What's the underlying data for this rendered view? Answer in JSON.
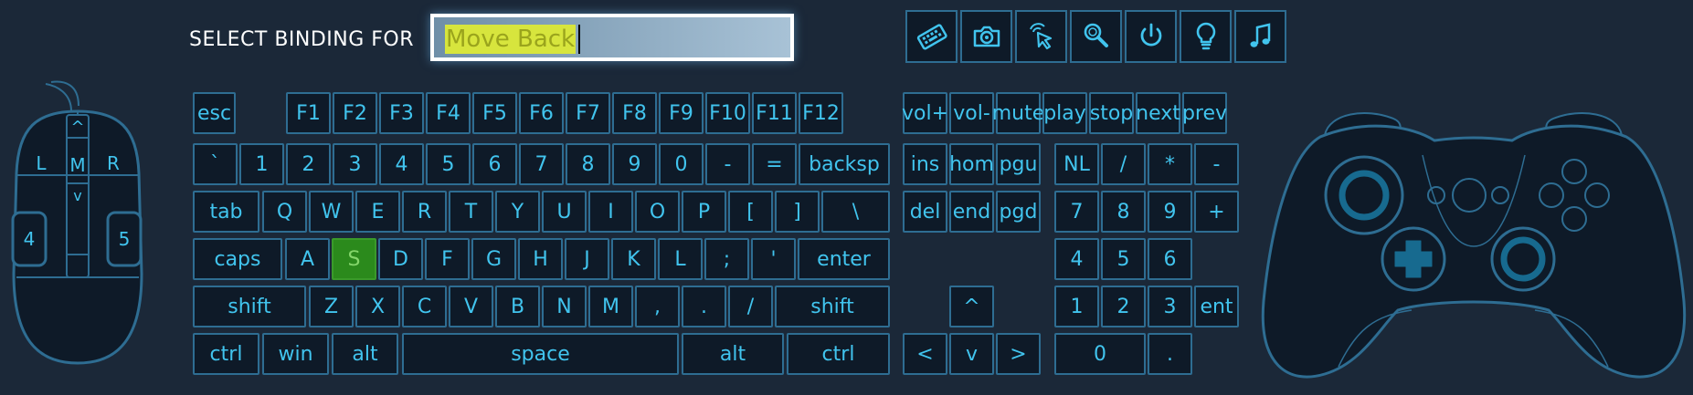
{
  "header": {
    "title": "SELECT BINDING FOR",
    "binding_value": "Move Back"
  },
  "toolbar": [
    {
      "name": "keyboard-icon"
    },
    {
      "name": "camera-icon"
    },
    {
      "name": "cursor-click-icon"
    },
    {
      "name": "magnifier-icon"
    },
    {
      "name": "power-icon"
    },
    {
      "name": "lightbulb-icon"
    },
    {
      "name": "music-note-icon"
    }
  ],
  "mouse": {
    "left": "L",
    "middle": "M",
    "right": "R",
    "up": "^",
    "down": "v",
    "button4": "4",
    "button5": "5"
  },
  "keyboard": {
    "row0": [
      "esc",
      "F1",
      "F2",
      "F3",
      "F4",
      "F5",
      "F6",
      "F7",
      "F8",
      "F9",
      "F10",
      "F11",
      "F12"
    ],
    "row1": [
      "`",
      "1",
      "2",
      "3",
      "4",
      "5",
      "6",
      "7",
      "8",
      "9",
      "0",
      "-",
      "=",
      "backsp"
    ],
    "row2": [
      "tab",
      "Q",
      "W",
      "E",
      "R",
      "T",
      "Y",
      "U",
      "I",
      "O",
      "P",
      "[",
      "]",
      "\\"
    ],
    "row3": [
      "caps",
      "A",
      "S",
      "D",
      "F",
      "G",
      "H",
      "J",
      "K",
      "L",
      ";",
      "'",
      "enter"
    ],
    "row4": [
      "shift",
      "Z",
      "X",
      "C",
      "V",
      "B",
      "N",
      "M",
      ",",
      ".",
      "/",
      "shift"
    ],
    "row5": [
      "ctrl",
      "win",
      "alt",
      "space",
      "alt",
      "ctrl"
    ]
  },
  "selected_key": "S",
  "media": [
    "vol+",
    "vol-",
    "mute",
    "play",
    "stop",
    "next",
    "prev"
  ],
  "nav": {
    "row1": [
      "ins",
      "hom",
      "pgu"
    ],
    "row2": [
      "del",
      "end",
      "pgd"
    ]
  },
  "arrows": {
    "up": "^",
    "left": "<",
    "down": "v",
    "right": ">"
  },
  "numpad": {
    "row1": [
      "NL",
      "/",
      "*",
      "-"
    ],
    "row2": [
      "7",
      "8",
      "9",
      "+"
    ],
    "row3": [
      "4",
      "5",
      "6"
    ],
    "row4": [
      "1",
      "2",
      "3",
      "ent"
    ],
    "row5": [
      "0",
      "."
    ]
  },
  "colors": {
    "background": "#1b2838",
    "key_text": "#41c4ee",
    "key_border": "#2e6d92",
    "selected": "#2b8a1c",
    "highlight": "#d7e53d"
  }
}
